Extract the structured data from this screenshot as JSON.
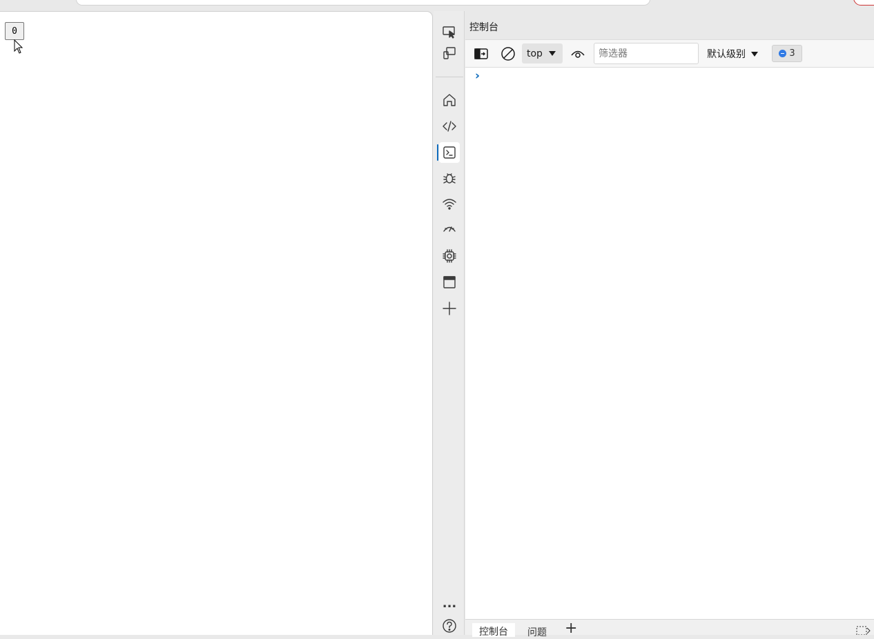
{
  "page": {
    "button_label": "0"
  },
  "devtools": {
    "activity_bar": {
      "items": [
        {
          "name": "inspect-tool"
        },
        {
          "name": "device-emulation"
        },
        {
          "name": "welcome"
        },
        {
          "name": "elements"
        },
        {
          "name": "console",
          "active": true
        },
        {
          "name": "sources"
        },
        {
          "name": "network"
        },
        {
          "name": "performance"
        },
        {
          "name": "memory"
        },
        {
          "name": "application"
        },
        {
          "name": "more-tools"
        }
      ],
      "more_label": "...",
      "help_label": "?"
    },
    "panel_title": "控制台",
    "toolbar": {
      "context": "top",
      "filter_placeholder": "筛选器",
      "level": "默认级别",
      "message_count": "3"
    },
    "console": {
      "prompt": "›"
    },
    "drawer": {
      "tabs": [
        "控制台",
        "问题"
      ],
      "add_label": "+"
    },
    "colors": {
      "accent": "#0f6cbd",
      "badge_blue": "#2f7ae5"
    }
  }
}
